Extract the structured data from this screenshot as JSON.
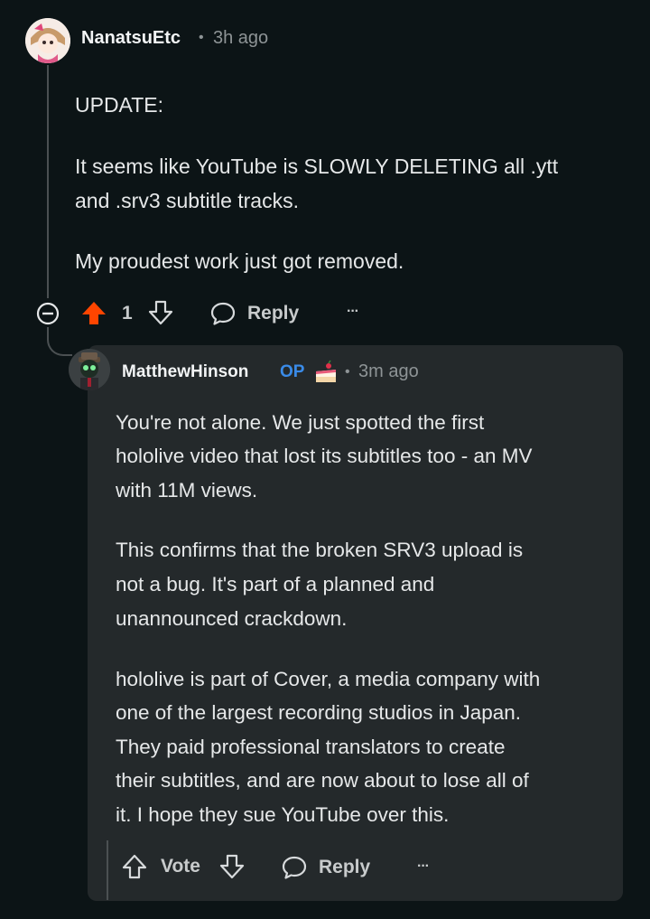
{
  "parent_comment": {
    "username": "NanatsuEtc",
    "separator": "•",
    "time": "3h ago",
    "paragraphs": [
      "UPDATE:",
      "It seems like YouTube is SLOWLY DELETING all .ytt",
      "and .srv3 subtitle tracks.",
      "My proudest work just got removed."
    ],
    "score": "1",
    "reply_label": "Reply",
    "more_label": "···",
    "colors": {
      "upvoted": "#ff4500"
    }
  },
  "reply_comment": {
    "username": "MatthewHinson",
    "op_label": "OP",
    "flair_icon": "cake-icon",
    "separator": "•",
    "time": "3m ago",
    "lines": [
      "You're not alone. We just spotted the first",
      "hololive video that lost its subtitles too - an MV",
      "with 11M views.",
      "This confirms that the broken SRV3 upload is",
      "not a bug. It's part of a planned and",
      "unannounced crackdown.",
      "hololive is part of Cover, a media company with",
      "one of the largest recording studios in Japan.",
      "They paid professional translators to create",
      "their subtitles, and are now about to lose all of",
      "it. I hope they sue YouTube over this."
    ],
    "vote_label": "Vote",
    "reply_label": "Reply",
    "more_label": "···",
    "colors": {
      "op": "#3a8be8",
      "card_bg": "#24292b"
    }
  }
}
